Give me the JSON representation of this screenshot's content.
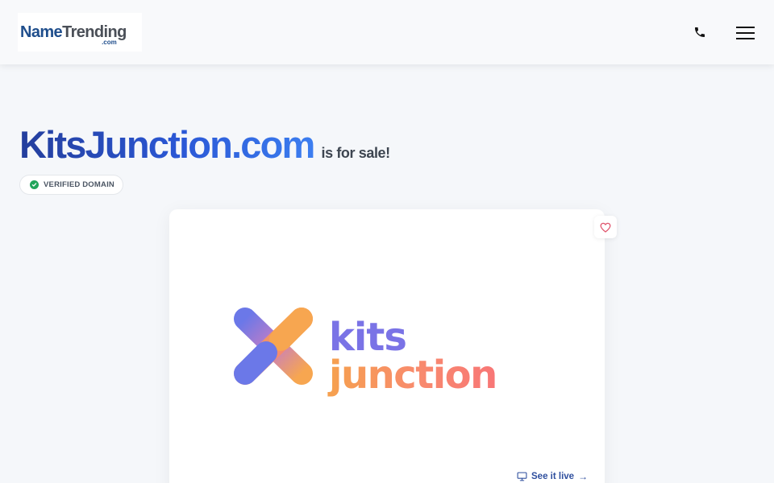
{
  "header": {
    "logo": {
      "name_part1": "Name",
      "name_part2": "Trending",
      "tld": ".com"
    },
    "phone_icon": "phone-icon",
    "menu_icon": "hamburger-menu-icon"
  },
  "hero": {
    "domain": "KitsJunction.com",
    "for_sale": "is for sale!",
    "verified_label": "VERIFIED DOMAIN"
  },
  "card": {
    "brand": {
      "line1": "kits",
      "line2": "junction"
    },
    "favorite_icon": "heart-icon",
    "see_live": {
      "label": "See it live",
      "arrow": "→",
      "icon": "monitor-icon"
    }
  },
  "colors": {
    "accent_blue": "#2b58d6",
    "logo_navy": "#1f4e8c",
    "verified_green": "#22a55b",
    "brand_purple": "#7a73e6",
    "brand_orange": "#f7a650",
    "brand_coral": "#f87878",
    "heart_red": "#e0566e"
  }
}
